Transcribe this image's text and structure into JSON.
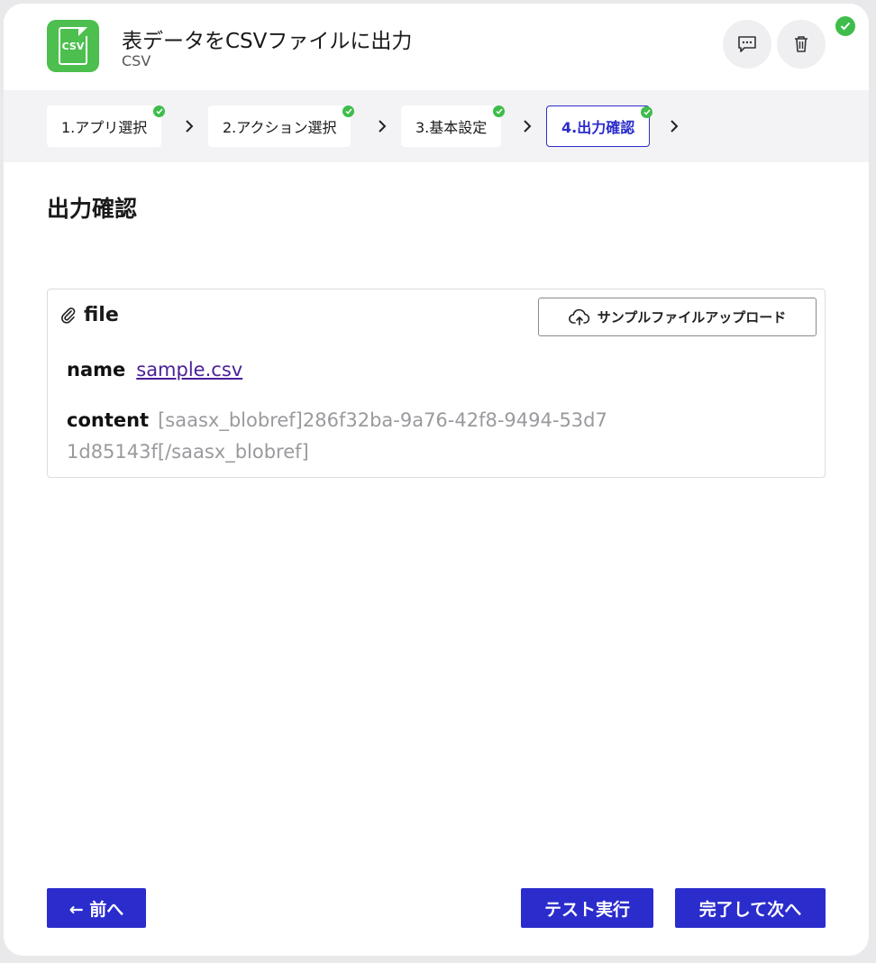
{
  "header": {
    "app_icon_text": "CSV",
    "title": "表データをCSVファイルに出力",
    "subtitle": "CSV"
  },
  "steps": [
    {
      "label": "1.アプリ選択",
      "done": true
    },
    {
      "label": "2.アクション選択",
      "done": true
    },
    {
      "label": "3.基本設定",
      "done": true
    },
    {
      "label": "4.出力確認",
      "done": true,
      "active": true
    }
  ],
  "main": {
    "section_title": "出力確認",
    "file": {
      "label": "file",
      "upload_button": "サンプルファイルアップロード",
      "name_key": "name",
      "name_value": "sample.csv",
      "content_key": "content",
      "content_value": "[saasx_blobref]286f32ba-9a76-42f8-9494-53d71d85143f[/saasx_blobref]"
    }
  },
  "footer": {
    "prev": "← 前へ",
    "test": "テスト実行",
    "next": "完了して次へ"
  },
  "colors": {
    "accent": "#2b2ccc",
    "success": "#3ebd4b",
    "app_icon": "#4dbf4f",
    "link": "#4b1f99"
  },
  "icons": [
    "csv-file-icon",
    "comment-icon",
    "trash-icon",
    "check-icon",
    "chevron-right-icon",
    "paperclip-icon",
    "cloud-upload-icon"
  ]
}
